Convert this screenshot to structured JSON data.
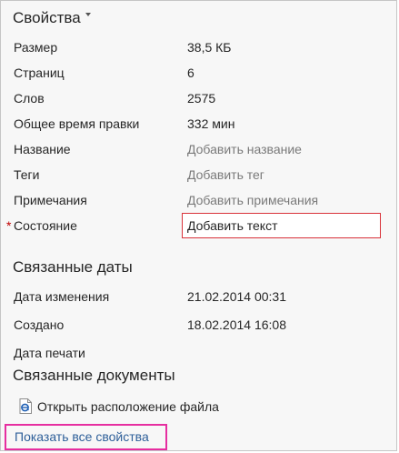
{
  "properties": {
    "title": "Свойства",
    "rows": [
      {
        "label": "Размер",
        "value": "38,5 КБ"
      },
      {
        "label": "Страниц",
        "value": "6"
      },
      {
        "label": "Слов",
        "value": "2575"
      },
      {
        "label": "Общее время правки",
        "value": "332 мин"
      },
      {
        "label": "Название",
        "value": "Добавить название"
      },
      {
        "label": "Теги",
        "value": "Добавить тег"
      },
      {
        "label": "Примечания",
        "value": "Добавить примечания"
      }
    ],
    "status": {
      "required_mark": "*",
      "label": "Состояние",
      "value": "Добавить текст"
    }
  },
  "related_dates": {
    "title": "Связанные даты",
    "rows": [
      {
        "label": "Дата изменения",
        "value": "21.02.2014 00:31"
      },
      {
        "label": "Создано",
        "value": "18.02.2014 16:08"
      },
      {
        "label": "Дата печати",
        "value": ""
      }
    ]
  },
  "related_docs": {
    "title": "Связанные документы",
    "open_location": "Открыть расположение файла",
    "icon": "document-explorer-icon"
  },
  "footer": {
    "show_all": "Показать все свойства"
  },
  "colors": {
    "link": "#2e5f99",
    "hint": "#7a7a7a",
    "required": "#c00000",
    "highlight_box": "#d9323a",
    "show_all_border": "#e62ea0",
    "icon_blue": "#1e5fb4"
  }
}
